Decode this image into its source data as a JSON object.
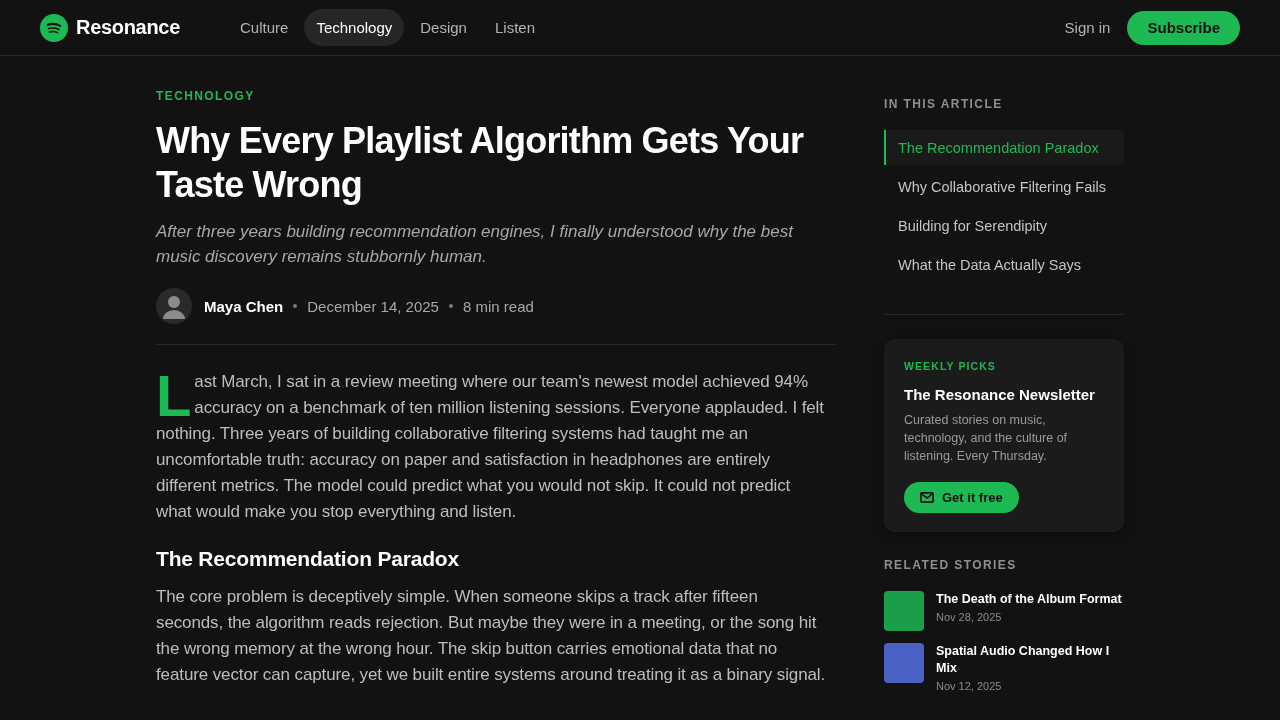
{
  "header": {
    "brand": "Resonance",
    "nav": [
      {
        "label": "Culture",
        "selected": false
      },
      {
        "label": "Technology",
        "selected": true
      },
      {
        "label": "Design",
        "selected": false
      },
      {
        "label": "Listen",
        "selected": false
      }
    ],
    "sign_in": "Sign in",
    "subscribe": "Subscribe"
  },
  "article": {
    "category": "TECHNOLOGY",
    "title": "Why Every Playlist Algorithm Gets Your Taste Wrong",
    "subtitle": "After three years building recommendation engines, I finally understood why the best music discovery remains stubbornly human.",
    "author": "Maya Chen",
    "date": "December 14, 2025",
    "read_time": "8 min read",
    "body": [
      {
        "kind": "lead",
        "text": "Last March, I sat in a review meeting where our team's newest model achieved 94% accuracy on a benchmark of ten million listening sessions. Everyone applauded. I felt nothing. Three years of building collaborative filtering systems had taught me an uncomfortable truth: accuracy on paper and satisfaction in headphones are entirely different metrics. The model could predict what you would not skip. It could not predict what would make you stop everything and listen."
      },
      {
        "kind": "heading",
        "text": "The Recommendation Paradox"
      },
      {
        "kind": "paragraph",
        "text": "The core problem is deceptively simple. When someone skips a track after fifteen seconds, the algorithm reads rejection. But maybe they were in a meeting, or the song hit the wrong memory at the wrong hour. The skip button carries emotional data that no feature vector can capture, yet we built entire systems around treating it as a binary signal."
      }
    ]
  },
  "sidebar": {
    "toc": {
      "heading": "IN THIS ARTICLE",
      "items": [
        {
          "label": "The Recommendation Paradox",
          "selected": true
        },
        {
          "label": "Why Collaborative Filtering Fails",
          "selected": false
        },
        {
          "label": "Building for Serendipity",
          "selected": false
        },
        {
          "label": "What the Data Actually Says",
          "selected": false
        }
      ]
    },
    "newsletter": {
      "eyebrow": "WEEKLY PICKS",
      "title": "The Resonance Newsletter",
      "description": "Curated stories on music, technology, and the culture of listening. Every Thursday.",
      "button": "Get it free"
    },
    "related": {
      "heading": "RELATED STORIES",
      "items": [
        {
          "title": "The Death of the Album Format",
          "date": "Nov 28, 2025",
          "color": "#1a9e4a"
        },
        {
          "title": "Spatial Audio Changed How I Mix",
          "date": "Nov 12, 2025",
          "color": "#4a62c4"
        }
      ]
    }
  }
}
